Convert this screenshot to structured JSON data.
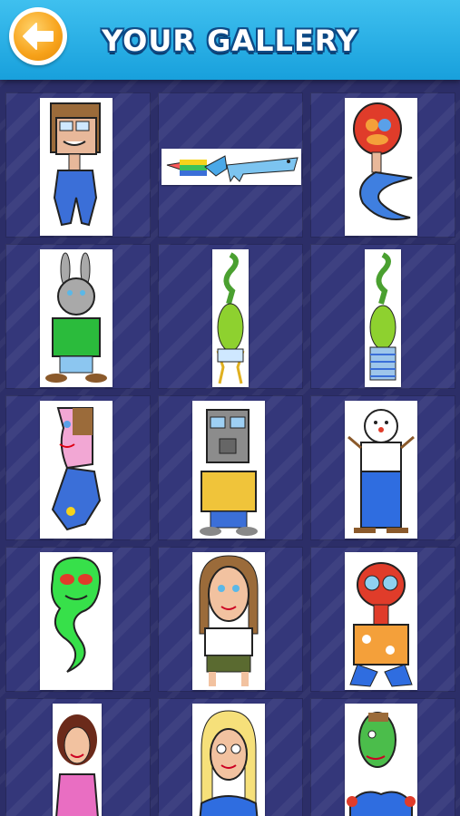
{
  "header": {
    "title": "YOUR GALLERY",
    "back_icon": "back-arrow-icon",
    "colors": {
      "bar": "#1fa9e1",
      "button": "#f7a21a"
    }
  },
  "gallery": {
    "items": [
      "man-blue-pants",
      "rainbow-dog-horse",
      "red-head-blue-serpent",
      "bunny-green-shirt",
      "green-dragon",
      "green-dragon-striped-legs",
      "pink-face-blue-hand",
      "robot-yellow-shirt",
      "snowman-blue-pants",
      "green-ghost-serpent",
      "woman-white-shirt",
      "red-creature-hawaiian",
      "girl-pink-dress",
      "blonde-woman-blue",
      "green-face-blue-shirt"
    ]
  }
}
